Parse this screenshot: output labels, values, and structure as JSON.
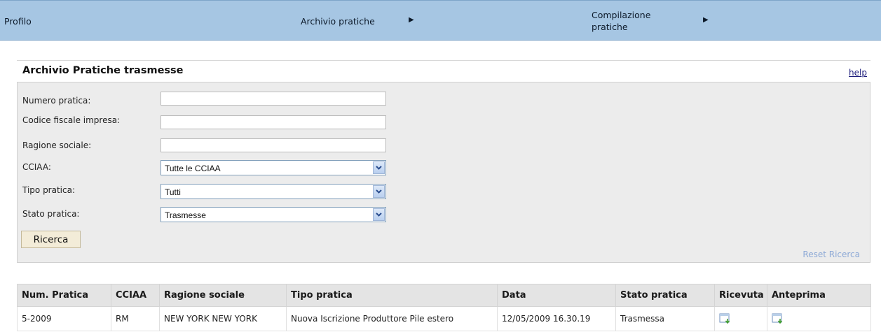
{
  "nav": {
    "profilo": "Profilo",
    "archivio": "Archivio pratiche",
    "compilazione": "Compilazione pratiche",
    "arrow_icon": "triangle-right-icon"
  },
  "section": {
    "title": "Archivio Pratiche trasmesse",
    "help": "help"
  },
  "form": {
    "numero_label": "Numero pratica:",
    "numero_value": "",
    "codice_label": "Codice fiscale impresa:",
    "codice_value": "",
    "ragione_label": "Ragione sociale:",
    "ragione_value": "",
    "cciaa_label": "CCIAA:",
    "cciaa_selected": "Tutte le CCIAA",
    "tipo_label": "Tipo pratica:",
    "tipo_selected": "Tutti",
    "stato_label": "Stato pratica:",
    "stato_selected": "Trasmesse",
    "ricerca_button": "Ricerca",
    "reset_link": "Reset Ricerca"
  },
  "table": {
    "headers": [
      "Num. Pratica",
      "CCIAA",
      "Ragione sociale",
      "Tipo pratica",
      "Data",
      "Stato pratica",
      "Ricevuta",
      "Anteprima"
    ],
    "rows": [
      {
        "num": "5-2009",
        "cciaa": "RM",
        "ragione": "NEW YORK NEW YORK",
        "tipo": "Nuova Iscrizione Produttore Pile estero",
        "data": "12/05/2009 16.30.19",
        "stato": "Trasmessa",
        "ricevuta_icon": "download-document-icon",
        "anteprima_icon": "download-document-icon"
      }
    ]
  },
  "colors": {
    "nav_bg": "#a6c6e3",
    "panel_bg": "#ececec",
    "button_bg": "#f3ecd8",
    "link_blue": "#8da9d6"
  }
}
